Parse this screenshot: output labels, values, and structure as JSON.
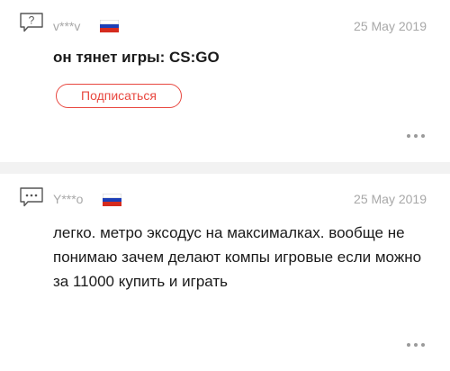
{
  "question": {
    "username": "v***v",
    "date": "25 May 2019",
    "text": "он тянет игры: CS:GO",
    "subscribe_label": "Подписаться",
    "type_icon": "question-bubble-icon",
    "flag_icon": "russia-flag-icon",
    "more_icon": "more-dots-icon"
  },
  "answer": {
    "username": "Y***o",
    "date": "25 May 2019",
    "text": "легко.  метро эксодус на максималках. вообще не понимаю зачем делают компы игровые если можно за 11000 купить и играть",
    "type_icon": "answer-bubble-icon",
    "flag_icon": "russia-flag-icon",
    "more_icon": "more-dots-icon"
  },
  "colors": {
    "accent": "#e8473f",
    "muted_text": "#a8a8a8",
    "separator": "#f2f2f2",
    "body_text": "#1a1a1a"
  }
}
